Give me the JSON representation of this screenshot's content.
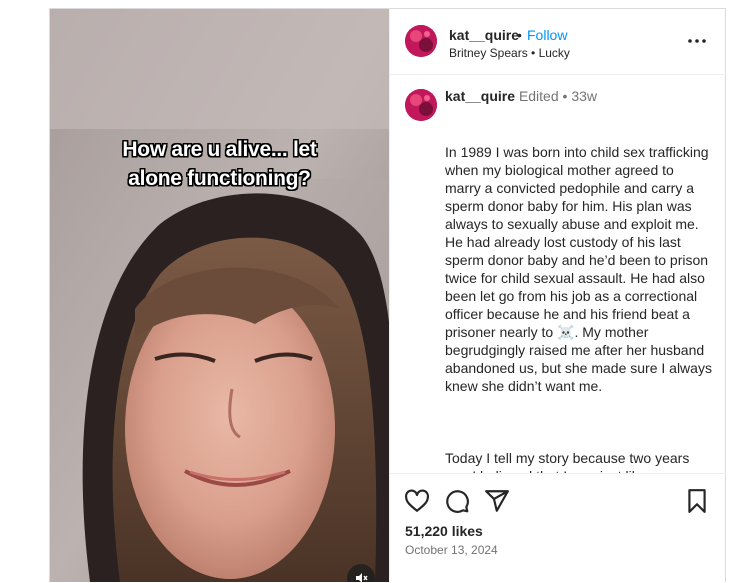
{
  "video": {
    "overlay_line1": "How are u alive... let",
    "overlay_line2": "alone functioning?"
  },
  "header": {
    "username": "kat__quire",
    "separator": "•",
    "follow_label": "Follow",
    "audio_text": "Britney Spears • Lucky"
  },
  "caption": {
    "username": "kat__quire",
    "edited": "Edited",
    "dot": "•",
    "age": "33w",
    "paragraph1": "In 1989 I was born into child sex trafficking when my biological mother agreed to marry a convicted pedophile and carry a sperm donor baby for him. His plan was always to sexually abuse and exploit me. He had already lost custody of his last sperm donor baby and he’d been to prison twice for child sexual assault. He had also been let go from his job as a correctional officer because he and his friend beat a prisoner nearly to ☠️. My mother begrudgingly raised me after her husband abandoned us, but she made sure I always knew she didn’t want me.",
    "paragraph2": "Today I tell my story because two years ago I believed that I was just like everyone else... except I hated myself because couldn’t ever quite figure out how to be an adult the way that my peers were able to be... stable... secure about themselves"
  },
  "footer": {
    "likes": "51,220 likes",
    "date": "October 13, 2024"
  },
  "colors": {
    "follow": "#0095f6",
    "avatar": "#c2185b",
    "text": "#262626",
    "muted": "#737373"
  },
  "icons": [
    "more-icon",
    "heart-icon",
    "comment-icon",
    "share-icon",
    "bookmark-icon",
    "mute-icon"
  ]
}
